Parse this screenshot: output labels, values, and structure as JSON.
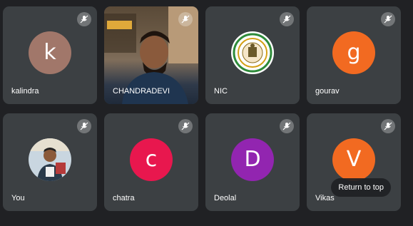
{
  "participants": [
    {
      "name": "kalindra",
      "initial": "k",
      "color": "#a1776a",
      "type": "initial"
    },
    {
      "name": "CHANDRADEVI",
      "type": "video"
    },
    {
      "name": "NIC",
      "type": "logo"
    },
    {
      "name": "gourav",
      "initial": "g",
      "color": "#f26a21",
      "type": "initial"
    },
    {
      "name": "You",
      "type": "photo"
    },
    {
      "name": "chatra",
      "initial": "c",
      "color": "#e8174e",
      "type": "initial"
    },
    {
      "name": "Deolal",
      "initial": "D",
      "color": "#9225b0",
      "type": "initial"
    },
    {
      "name": "Vikas",
      "initial": "V",
      "color": "#f26a21",
      "type": "initial"
    }
  ],
  "overlay": {
    "return_to_top": "Return to top"
  },
  "icons": {
    "mic_muted": "mic-off-icon"
  }
}
